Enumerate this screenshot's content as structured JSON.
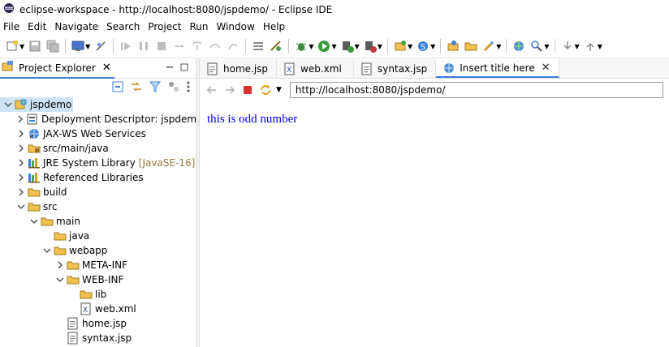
{
  "window": {
    "title": "eclipse-workspace - http://localhost:8080/jspdemo/ - Eclipse IDE"
  },
  "menu": [
    "File",
    "Edit",
    "Navigate",
    "Search",
    "Project",
    "Run",
    "Window",
    "Help"
  ],
  "project_explorer": {
    "tab_label": "Project Explorer",
    "tree": [
      {
        "label": "jspdemo",
        "depth": 0,
        "expanded": true,
        "icon": "web-project-icon",
        "selected": true
      },
      {
        "label": "Deployment Descriptor: jspdemo",
        "depth": 1,
        "expanded": false,
        "icon": "deployment-descriptor-icon"
      },
      {
        "label": "JAX-WS Web Services",
        "depth": 1,
        "expanded": false,
        "icon": "web-services-icon"
      },
      {
        "label": "src/main/java",
        "depth": 1,
        "expanded": false,
        "icon": "source-folder-icon"
      },
      {
        "label": "JRE System Library",
        "decoration": "[JavaSE-16]",
        "depth": 1,
        "expanded": false,
        "icon": "library-icon"
      },
      {
        "label": "Referenced Libraries",
        "depth": 1,
        "expanded": false,
        "icon": "library-icon"
      },
      {
        "label": "build",
        "depth": 1,
        "expanded": false,
        "icon": "folder-icon"
      },
      {
        "label": "src",
        "depth": 1,
        "expanded": true,
        "icon": "folder-icon"
      },
      {
        "label": "main",
        "depth": 2,
        "expanded": true,
        "icon": "folder-icon"
      },
      {
        "label": "java",
        "depth": 3,
        "leaf": true,
        "icon": "folder-icon"
      },
      {
        "label": "webapp",
        "depth": 3,
        "expanded": true,
        "icon": "folder-icon"
      },
      {
        "label": "META-INF",
        "depth": 4,
        "expanded": false,
        "icon": "folder-icon"
      },
      {
        "label": "WEB-INF",
        "depth": 4,
        "expanded": true,
        "icon": "folder-icon"
      },
      {
        "label": "lib",
        "depth": 5,
        "leaf": true,
        "icon": "folder-icon"
      },
      {
        "label": "web.xml",
        "depth": 5,
        "leaf": true,
        "icon": "xml-file-icon"
      },
      {
        "label": "home.jsp",
        "depth": 4,
        "leaf": true,
        "icon": "jsp-file-icon"
      },
      {
        "label": "syntax.jsp",
        "depth": 4,
        "leaf": true,
        "icon": "jsp-file-icon"
      }
    ]
  },
  "editor": {
    "tabs": [
      {
        "label": "home.jsp",
        "icon": "jsp-file-icon",
        "active": false
      },
      {
        "label": "web.xml",
        "icon": "xml-file-icon",
        "active": false
      },
      {
        "label": "syntax.jsp",
        "icon": "jsp-file-icon",
        "active": false
      },
      {
        "label": "Insert title here",
        "icon": "globe-icon",
        "active": true,
        "closable": true
      }
    ],
    "browser": {
      "url": "http://localhost:8080/jspdemo/",
      "page_text": "this is odd number"
    }
  },
  "colors": {
    "link_text": "#0000ee",
    "accent": "#3f7dd8",
    "selection": "#cde4f7"
  }
}
